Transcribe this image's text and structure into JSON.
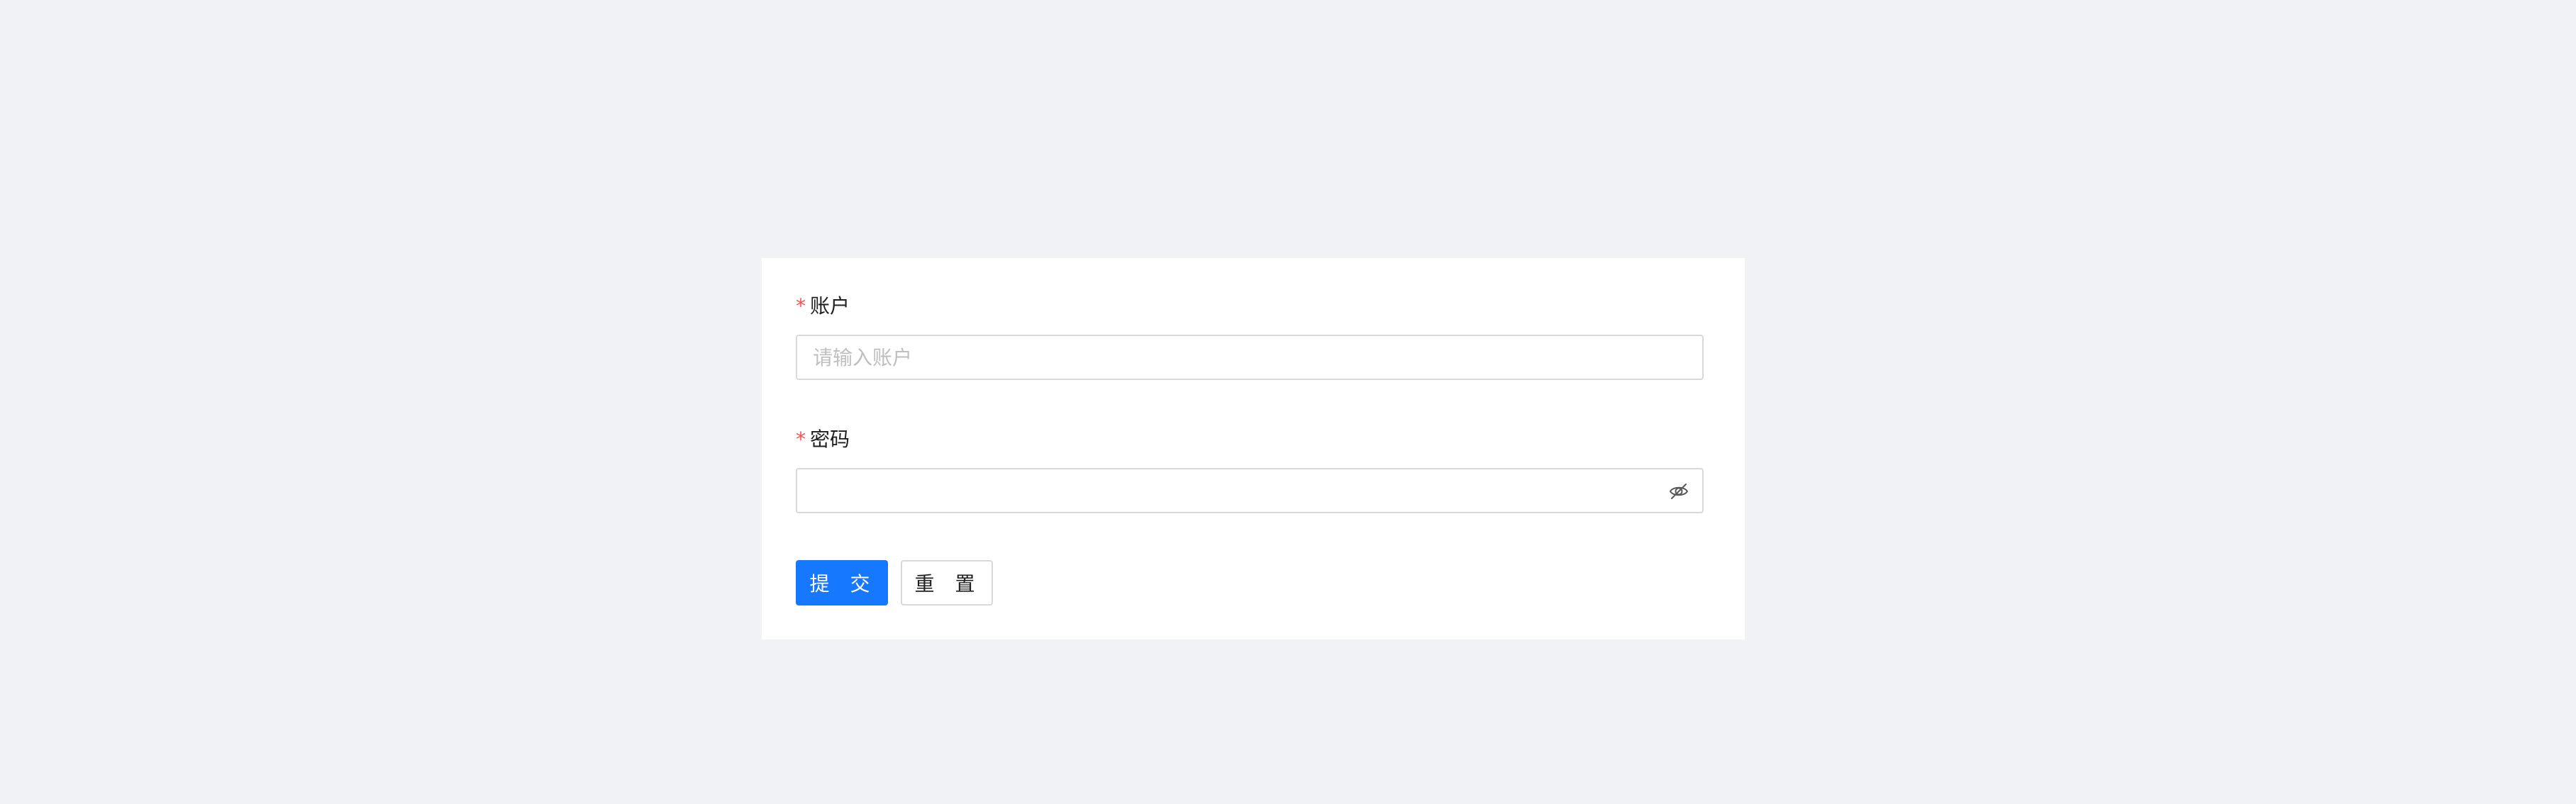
{
  "form": {
    "account": {
      "required_mark": "*",
      "label": "账户",
      "placeholder": "请输入账户",
      "value": ""
    },
    "password": {
      "required_mark": "*",
      "label": "密码",
      "placeholder": "",
      "value": "",
      "visibility_icon": "eye-invisible-icon"
    }
  },
  "actions": {
    "submit_label": "提 交",
    "reset_label": "重 置"
  },
  "colors": {
    "background": "#f0f2f5",
    "card": "#ffffff",
    "primary": "#1677ff",
    "required": "#ff4d4f",
    "border": "#d9d9d9",
    "placeholder": "#bfbfbf"
  }
}
